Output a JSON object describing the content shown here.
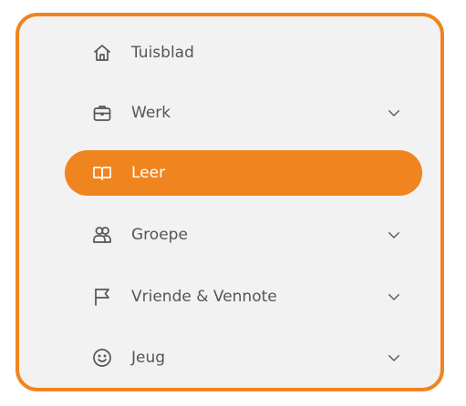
{
  "nav": {
    "items": [
      {
        "label": "Tuisblad",
        "icon": "home-icon",
        "expandable": false,
        "active": false
      },
      {
        "label": "Werk",
        "icon": "briefcase-icon",
        "expandable": true,
        "active": false
      },
      {
        "label": "Leer",
        "icon": "book-icon",
        "expandable": false,
        "active": true
      },
      {
        "label": "Groepe",
        "icon": "users-icon",
        "expandable": true,
        "active": false
      },
      {
        "label": "Vriende & Vennote",
        "icon": "flag-icon",
        "expandable": true,
        "active": false
      },
      {
        "label": "Jeug",
        "icon": "smiley-icon",
        "expandable": true,
        "active": false
      }
    ]
  },
  "colors": {
    "accent": "#f0841e",
    "panel_bg": "#f2f2f2",
    "text": "#555555"
  }
}
